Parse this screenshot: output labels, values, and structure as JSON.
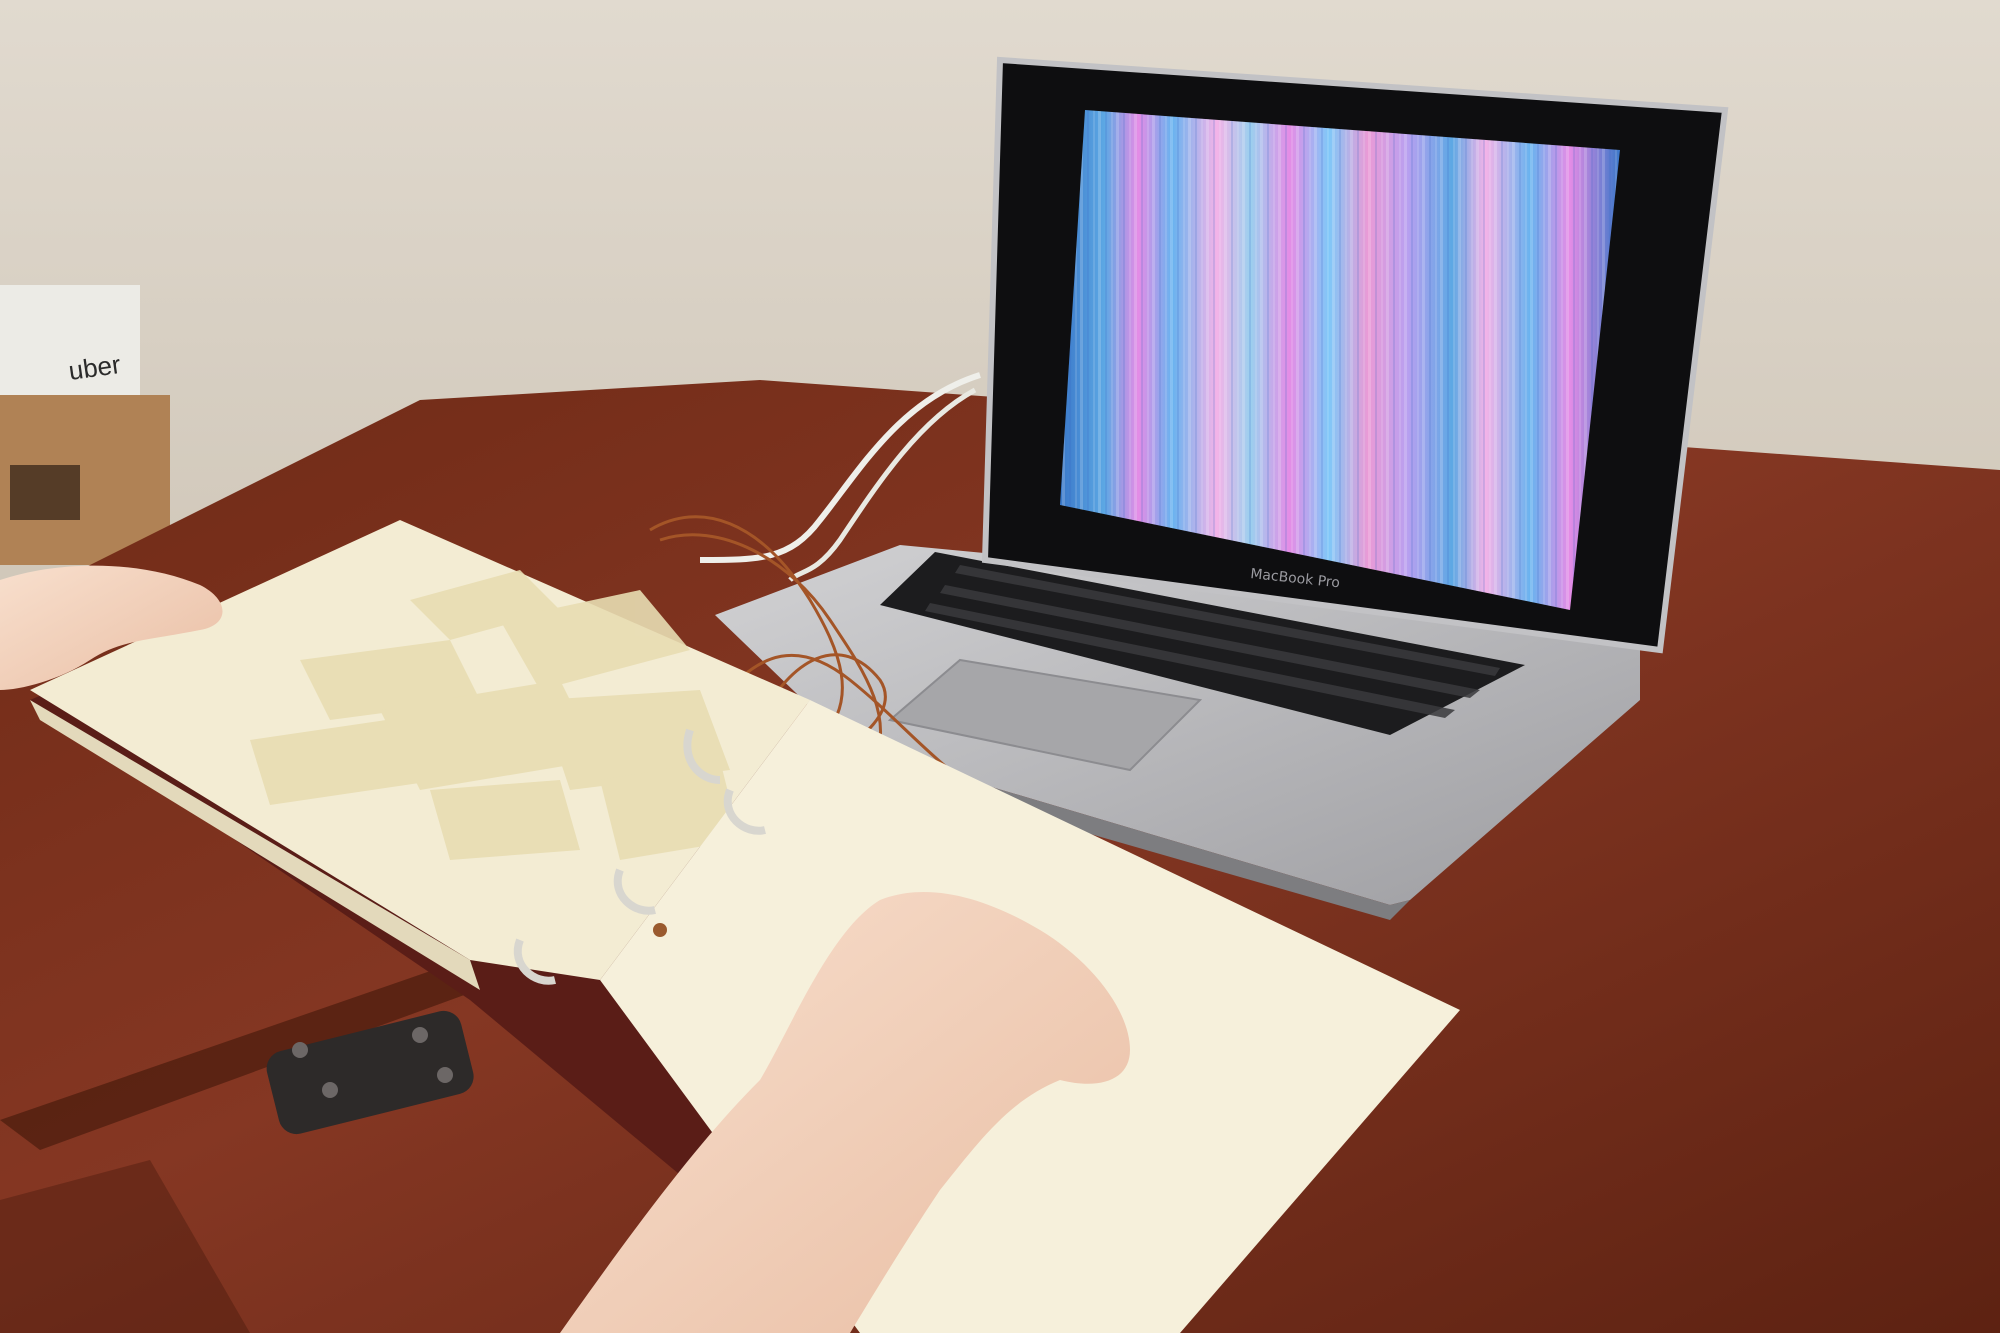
{
  "scene": {
    "laptop": {
      "brand_label": "MacBook Pro",
      "screen_pattern": "vertical-stripes",
      "stripe_colors": [
        "#e58ce6",
        "#ea9ad6",
        "#9bd0ef",
        "#68b3ef",
        "#3a78c9",
        "#b9a0f0",
        "#f4b3e8",
        "#7fc8f8",
        "#c6e9f9",
        "#5da8e4",
        "#9a63d9",
        "#c7f2cf"
      ]
    },
    "box": {
      "label": "uber"
    },
    "colors": {
      "wall": "#ddd6cb",
      "table": "#7b2f1c",
      "paper": "#f4efdc",
      "skin": "#f3d2bd",
      "aluminum": "#b9b9bb",
      "wire": "#a45527"
    }
  }
}
